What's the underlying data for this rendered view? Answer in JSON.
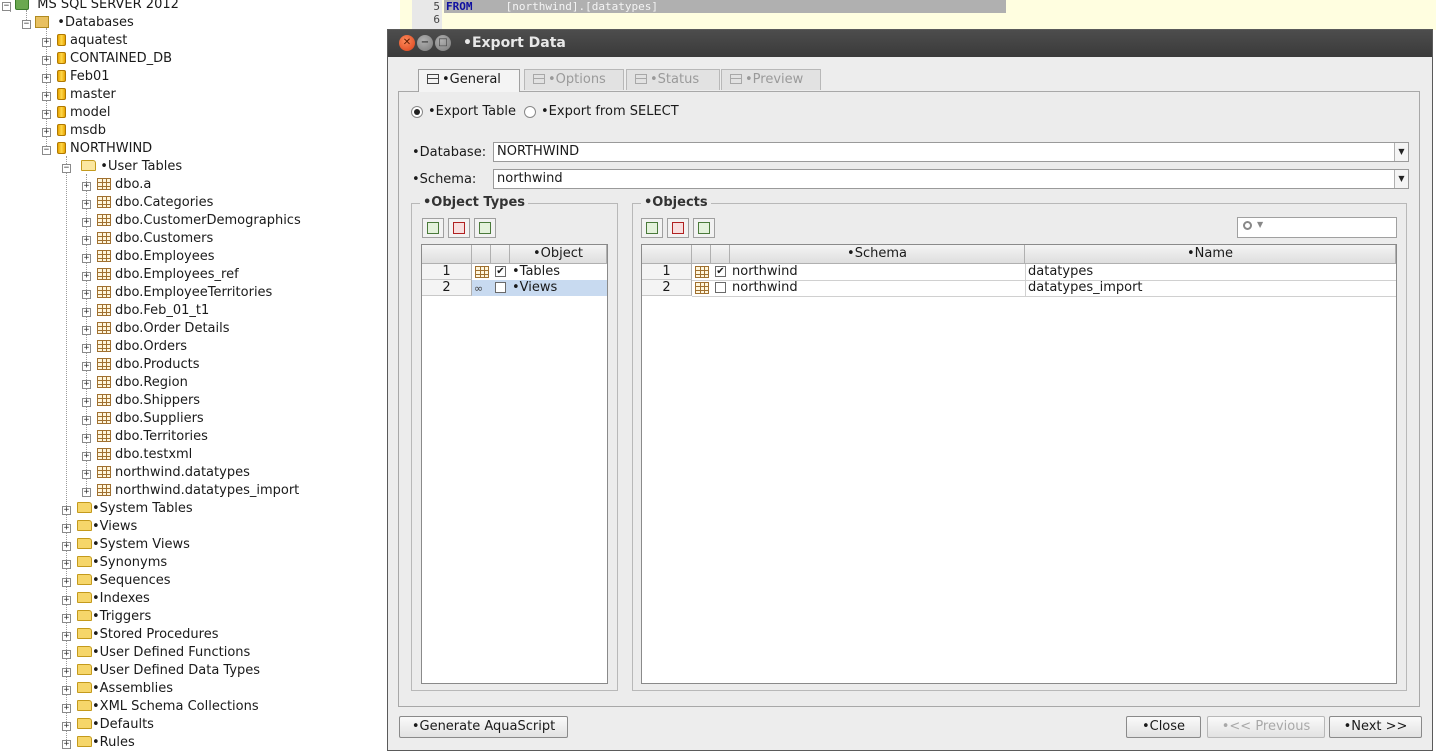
{
  "tree": {
    "server": "MS SQL SERVER 2012",
    "databases_label": "•Databases",
    "databases": [
      "aquatest",
      "CONTAINED_DB",
      "Feb01",
      "master",
      "model",
      "msdb",
      "NORTHWIND"
    ],
    "user_tables_label": "•User Tables",
    "tables": [
      "dbo.a",
      "dbo.Categories",
      "dbo.CustomerDemographics",
      "dbo.Customers",
      "dbo.Employees",
      "dbo.Employees_ref",
      "dbo.EmployeeTerritories",
      "dbo.Feb_01_t1",
      "dbo.Order Details",
      "dbo.Orders",
      "dbo.Products",
      "dbo.Region",
      "dbo.Shippers",
      "dbo.Suppliers",
      "dbo.Territories",
      "dbo.testxml",
      "northwind.datatypes",
      "northwind.datatypes_import"
    ],
    "folders": [
      "•System Tables",
      "•Views",
      "•System Views",
      "•Synonyms",
      "•Sequences",
      "•Indexes",
      "•Triggers",
      "•Stored Procedures",
      "•User Defined Functions",
      "•User Defined Data Types",
      "•Assemblies",
      "•XML Schema Collections",
      "•Defaults",
      "•Rules"
    ]
  },
  "editor": {
    "lines": [
      "5",
      "6"
    ],
    "keyword": "FROM",
    "text": "[northwind].[datatypes]"
  },
  "dialog": {
    "title": "•Export Data",
    "tabs": [
      "•General",
      "•Options",
      "•Status",
      "•Preview"
    ],
    "export_table": "•Export Table",
    "export_select": "•Export from SELECT",
    "database_label": "•Database:",
    "database_value": "NORTHWIND",
    "schema_label": "•Schema:",
    "schema_value": "northwind",
    "object_types": {
      "title": "•Object Types",
      "header": "•Object",
      "rows": [
        {
          "num": "1",
          "label": "•Tables",
          "checked": true
        },
        {
          "num": "2",
          "label": "•Views",
          "checked": false
        }
      ]
    },
    "objects": {
      "title": "•Objects",
      "search_placeholder": "",
      "headers": [
        "•Schema",
        "•Name"
      ],
      "rows": [
        {
          "num": "1",
          "schema": "northwind",
          "name": "datatypes",
          "checked": true
        },
        {
          "num": "2",
          "schema": "northwind",
          "name": "datatypes_import",
          "checked": false
        }
      ]
    },
    "buttons": {
      "generate": "•Generate AquaScript",
      "close": "•Close",
      "previous": "•<< Previous",
      "next": "•Next >>"
    }
  }
}
